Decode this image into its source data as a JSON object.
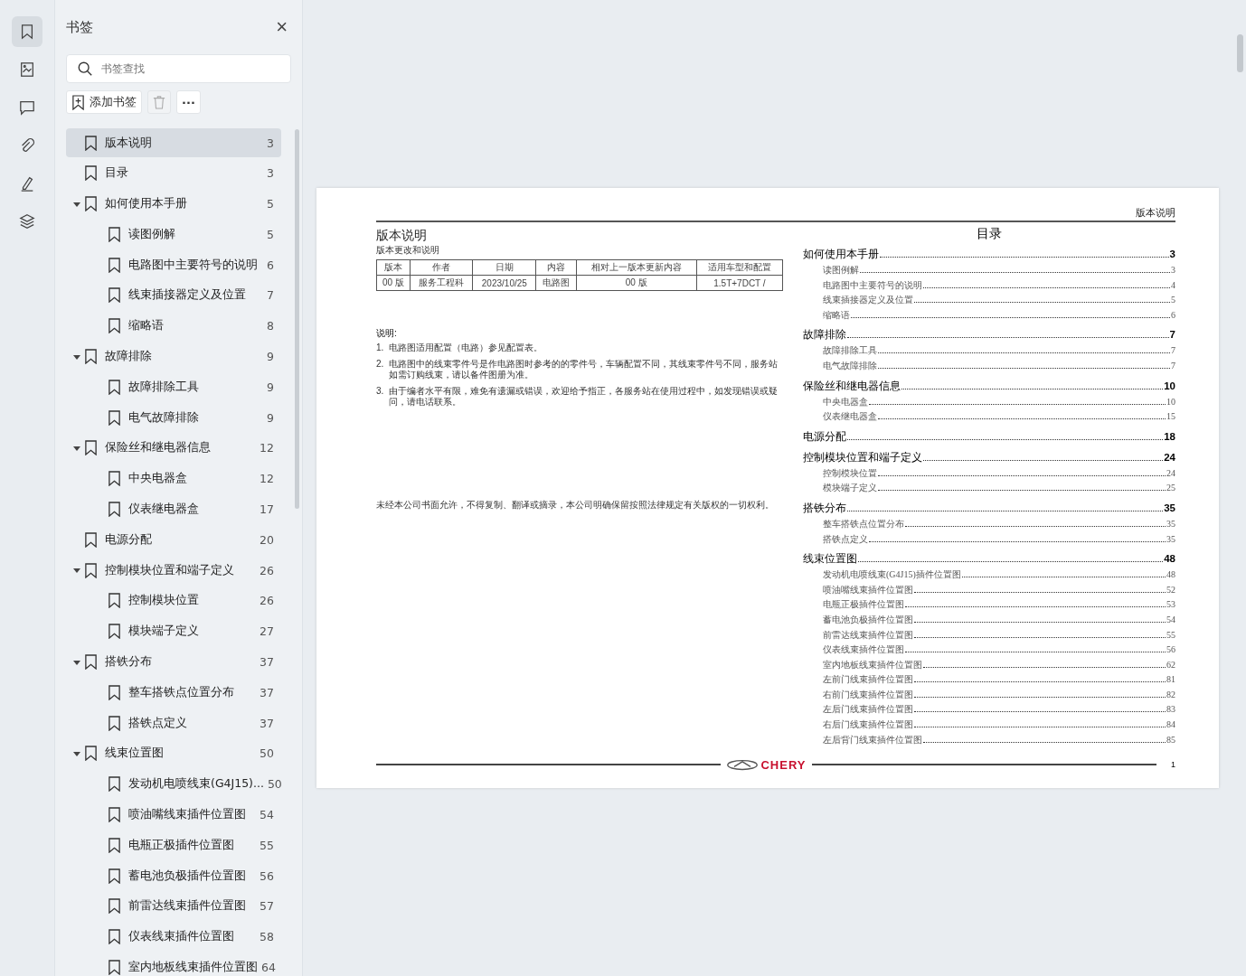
{
  "rail": [
    {
      "kind": "bookmark",
      "selected": true
    },
    {
      "kind": "image",
      "selected": false
    },
    {
      "kind": "comment",
      "selected": false
    },
    {
      "kind": "attachment",
      "selected": false
    },
    {
      "kind": "sign",
      "selected": false
    },
    {
      "kind": "layers",
      "selected": false
    }
  ],
  "panel": {
    "title": "书签",
    "close": "×",
    "search": {
      "placeholder": "书签查找"
    },
    "add_button": "添加书签",
    "more_button": "···"
  },
  "bookmarks": [
    {
      "title": "版本说明",
      "page": "3",
      "selected": true
    },
    {
      "title": "目录",
      "page": "3",
      "selected": false
    },
    {
      "title": "如何使用本手册",
      "page": "5",
      "selected": false,
      "expanded": true,
      "children": [
        {
          "title": "读图例解",
          "page": "5",
          "selected": false
        },
        {
          "title": "电路图中主要符号的说明",
          "page": "6",
          "selected": false
        },
        {
          "title": "线束插接器定义及位置",
          "page": "7",
          "selected": false
        },
        {
          "title": "缩略语",
          "page": "8",
          "selected": false
        }
      ]
    },
    {
      "title": "故障排除",
      "page": "9",
      "selected": false,
      "expanded": true,
      "children": [
        {
          "title": "故障排除工具",
          "page": "9",
          "selected": false
        },
        {
          "title": "电气故障排除",
          "page": "9",
          "selected": false
        }
      ]
    },
    {
      "title": "保险丝和继电器信息",
      "page": "12",
      "selected": false,
      "expanded": true,
      "children": [
        {
          "title": "中央电器盒",
          "page": "12",
          "selected": false
        },
        {
          "title": "仪表继电器盒",
          "page": "17",
          "selected": false
        }
      ]
    },
    {
      "title": "电源分配",
      "page": "20",
      "selected": false
    },
    {
      "title": "控制模块位置和端子定义",
      "page": "26",
      "selected": false,
      "expanded": true,
      "children": [
        {
          "title": "控制模块位置",
          "page": "26",
          "selected": false
        },
        {
          "title": "模块端子定义",
          "page": "27",
          "selected": false
        }
      ]
    },
    {
      "title": "搭铁分布",
      "page": "37",
      "selected": false,
      "expanded": true,
      "children": [
        {
          "title": "整车搭铁点位置分布",
          "page": "37",
          "selected": false
        },
        {
          "title": "搭铁点定义",
          "page": "37",
          "selected": false
        }
      ]
    },
    {
      "title": "线束位置图",
      "page": "50",
      "selected": false,
      "expanded": true,
      "children": [
        {
          "title": "发动机电喷线束(G4J15)...",
          "page": "50",
          "selected": false
        },
        {
          "title": "喷油嘴线束插件位置图",
          "page": "54",
          "selected": false
        },
        {
          "title": "电瓶正极插件位置图",
          "page": "55",
          "selected": false
        },
        {
          "title": "蓄电池负极插件位置图",
          "page": "56",
          "selected": false
        },
        {
          "title": "前雷达线束插件位置图",
          "page": "57",
          "selected": false
        },
        {
          "title": "仪表线束插件位置图",
          "page": "58",
          "selected": false
        },
        {
          "title": "室内地板线束插件位置图",
          "page": "64",
          "selected": false
        }
      ]
    }
  ],
  "document": {
    "header": "版本说明",
    "left": {
      "title": "版本说明",
      "subtitle": "版本更改和说明",
      "table": {
        "columns": [
          "版本",
          "作者",
          "日期",
          "内容",
          "相对上一版本更新内容",
          "适用车型和配置"
        ],
        "rows": [
          [
            "00 版",
            "服务工程科",
            "2023/10/25",
            "电路图",
            "00 版",
            "1.5T+7DCT /"
          ]
        ]
      },
      "notes_title": "说明:",
      "notes": [
        {
          "num": "1.",
          "text": "电路图适用配置（电路）参见配置表。"
        },
        {
          "num": "2.",
          "text": "电路图中的线束零件号是作电路图时参考的的零件号，车辆配置不同，其线束零件号不同，服务站如需订购线束，请以备件图册为准。"
        },
        {
          "num": "3.",
          "text": "由于编者水平有限，难免有遗漏或错误，欢迎给予指正，各服务站在使用过程中，如发现错误或疑问，请电话联系。"
        }
      ],
      "copyright": "未经本公司书面允许，不得复制、翻译或摘录，本公司明确保留按照法律规定有关版权的一切权利。"
    },
    "toc": {
      "title": "目录",
      "sections": [
        {
          "title": "如何使用本手册",
          "page": "3",
          "items": [
            {
              "title": "读图例解",
              "page": "3"
            },
            {
              "title": "电路图中主要符号的说明",
              "page": "4"
            },
            {
              "title": "线束插接器定义及位置",
              "page": "5"
            },
            {
              "title": "缩略语",
              "page": "6"
            }
          ]
        },
        {
          "title": "故障排除",
          "page": "7",
          "items": [
            {
              "title": "故障排除工具",
              "page": "7"
            },
            {
              "title": "电气故障排除",
              "page": "7"
            }
          ]
        },
        {
          "title": "保险丝和继电器信息",
          "page": "10",
          "items": [
            {
              "title": "中央电器盒",
              "page": "10"
            },
            {
              "title": "仪表继电器盒",
              "page": "15"
            }
          ]
        },
        {
          "title": "电源分配",
          "page": "18"
        },
        {
          "title": "控制模块位置和端子定义",
          "page": "24",
          "items": [
            {
              "title": "控制模块位置",
              "page": "24"
            },
            {
              "title": "模块端子定义",
              "page": "25"
            }
          ]
        },
        {
          "title": "搭铁分布",
          "page": "35",
          "items": [
            {
              "title": "整车搭铁点位置分布",
              "page": "35"
            },
            {
              "title": "搭铁点定义",
              "page": "35"
            }
          ]
        },
        {
          "title": "线束位置图",
          "page": "48",
          "items": [
            {
              "title": "发动机电喷线束(G4J15)插件位置图",
              "page": "48"
            },
            {
              "title": "喷油嘴线束插件位置图",
              "page": "52"
            },
            {
              "title": "电瓶正极插件位置图",
              "page": "53"
            },
            {
              "title": "蓄电池负极插件位置图",
              "page": "54"
            },
            {
              "title": "前雷达线束插件位置图",
              "page": "55"
            },
            {
              "title": "仪表线束插件位置图",
              "page": "56"
            },
            {
              "title": "室内地板线束插件位置图",
              "page": "62"
            },
            {
              "title": "左前门线束插件位置图",
              "page": "81"
            },
            {
              "title": "右前门线束插件位置图",
              "page": "82"
            },
            {
              "title": "左后门线束插件位置图",
              "page": "83"
            },
            {
              "title": "右后门线束插件位置图",
              "page": "84"
            },
            {
              "title": "左后背门线束插件位置图",
              "page": "85"
            }
          ]
        }
      ]
    },
    "footer": {
      "logo": "CHERY",
      "page_number": "1"
    }
  }
}
